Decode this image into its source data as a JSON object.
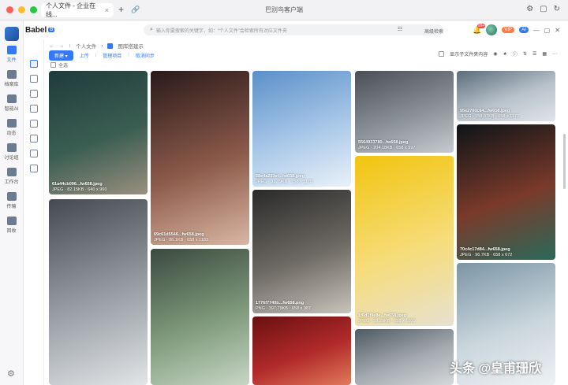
{
  "window": {
    "title": "巴别鸟客户端",
    "tab_label": "个人文件 - 企业在线...",
    "tab_close": "×",
    "new_tab": "+",
    "nav_back": "‹",
    "nav_forward": "›",
    "nav_reload": "↻"
  },
  "brand": {
    "name": "Babel",
    "badge": "B"
  },
  "search": {
    "placeholder": "输入你要搜索的关键字，如：“个人文件”会检索所有对应文件夹",
    "advanced_label": "高级检索"
  },
  "header": {
    "notif_count": "99+",
    "vip_label": "VIP",
    "ai_label": "AI"
  },
  "sidebar": {
    "items": [
      {
        "label": "文件",
        "icon": "folder-icon",
        "active": true
      },
      {
        "label": "档案库",
        "icon": "archive-icon"
      },
      {
        "label": "智能AI",
        "icon": "ai-icon"
      },
      {
        "label": "动态",
        "icon": "activity-icon"
      },
      {
        "label": "讨论组",
        "icon": "chat-icon"
      },
      {
        "label": "工作台",
        "icon": "grid-icon"
      },
      {
        "label": "传输",
        "icon": "transfer-icon"
      },
      {
        "label": "回收",
        "icon": "recycle-icon"
      }
    ]
  },
  "breadcrumb": {
    "root": "个人文件",
    "current": "图库搭建示"
  },
  "toolbar": {
    "new_label": "新建",
    "upload_label": "上传",
    "manage_label": "管理项目",
    "sync_label": "取消同步"
  },
  "right_tools": {
    "show_subfolder": "显示子文件夹内容"
  },
  "select_all": "全选",
  "gallery": [
    {
      "name": "61a44cb096...fw658.jpeg",
      "meta": "JPEG · 82.15KB · 640 x 960",
      "colors": [
        "#1f3b3a",
        "#3b5e52",
        "#9a8f7f"
      ]
    },
    {
      "name": "69c61d5546...fw658.jpeg",
      "meta": "JPEG · 86.1KB · 658 x 1183",
      "colors": [
        "#2a1a1a",
        "#8c5a4a",
        "#d9b7a4"
      ]
    },
    {
      "name": "58e4a293ef...fw658.jpeg",
      "meta": "JPEG · 31.79KB · 658 x 1170",
      "colors": [
        "#5b8fc9",
        "#a9c8e8",
        "#e9f1f8"
      ]
    },
    {
      "name": "5564933780...fw658.jpeg",
      "meta": "JPEG · 204.18KB · 658 x 997",
      "colors": [
        "#4a4f55",
        "#8a9098",
        "#c7cbd0"
      ]
    },
    {
      "name": "55e2700c64...fw658.jpeg",
      "meta": "JPEG · 158.07KB · 658 x 1172",
      "colors": [
        "#5a6c7a",
        "#b9c3cc",
        "#e0e4e8"
      ]
    },
    {
      "name": "70c4c17d84...fw658.jpeg",
      "meta": "JPEG · 96.7KB · 658 x 672",
      "colors": [
        "#0e1418",
        "#7a3a2a",
        "#2a6a5a"
      ]
    },
    {
      "name": "",
      "meta": "",
      "colors": [
        "#444a50",
        "#9aa0a6",
        "#e2e4e6"
      ]
    },
    {
      "name": "1776f7740b...fw658.png",
      "meta": "PNG · 397.79KB · 658 x 987",
      "colors": [
        "#2a2a2a",
        "#6e6a64",
        "#c8c4bc"
      ]
    },
    {
      "name": "1f6d1f9e8e...fw658.jpeg",
      "meta": "JPEG · 59.29KB · 658 x 1000",
      "colors": [
        "#f1c40f",
        "#f6dc78",
        "#e7e1d0"
      ]
    },
    {
      "name": "",
      "meta": "",
      "colors": [
        "#7b95a5",
        "#c9d5dc",
        "#eef2f4"
      ]
    },
    {
      "name": "",
      "meta": "",
      "colors": [
        "#3b4a3e",
        "#7f9a7c",
        "#c7d6c4"
      ]
    },
    {
      "name": "",
      "meta": "",
      "colors": [
        "#6a1010",
        "#b12a2a",
        "#e07a5a"
      ]
    },
    {
      "name": "",
      "meta": "",
      "colors": [
        "#4f5a62",
        "#a3a9ae",
        "#d6d8da"
      ]
    }
  ],
  "watermark": "头条 @皇甫珊欣"
}
